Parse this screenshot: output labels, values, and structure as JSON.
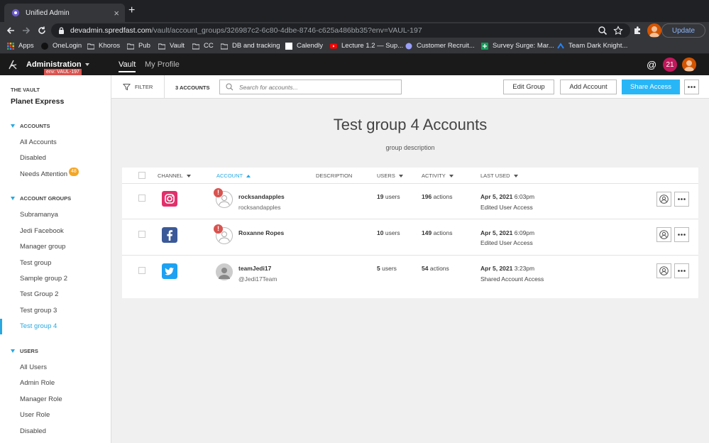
{
  "browser": {
    "tab_title": "Unified Admin",
    "new_tab": "+",
    "close": "×",
    "url_host": "devadmin.spredfast.com",
    "url_path": "/vault/account_groups/326987c2-6c80-4dbe-8746-c625a486bb35?env=VAUL-197",
    "update_label": "Update",
    "bookmarks": [
      "Apps",
      "OneLogin",
      "Khoros",
      "Pub",
      "Vault",
      "CC",
      "DB and tracking",
      "Calendly",
      "Lecture 1.2 — Sup...",
      "Customer Recruit...",
      "Survey Surge: Mar...",
      "Team Dark Knight..."
    ]
  },
  "header": {
    "app_title": "Administration",
    "env_badge": "env: VAUL-197",
    "nav": [
      "Vault",
      "My Profile"
    ],
    "at_symbol": "@",
    "notification_count": "21"
  },
  "sidebar": {
    "vault_label": "THE VAULT",
    "org_name": "Planet Express",
    "accounts_heading": "ACCOUNTS",
    "accounts_items": [
      "All Accounts",
      "Disabled",
      "Needs Attention"
    ],
    "needs_attention_count": "48",
    "groups_heading": "ACCOUNT GROUPS",
    "groups_items": [
      "Subramanya",
      "Jedi Facebook",
      "Manager group",
      "Test group",
      "Sample group 2",
      "Test Group 2",
      "Test group 3",
      "Test group 4"
    ],
    "active_group": "Test group 4",
    "users_heading": "USERS",
    "users_items": [
      "All Users",
      "Admin Role",
      "Manager Role",
      "User Role",
      "Disabled"
    ]
  },
  "toolbar": {
    "filter_label": "FILTER",
    "account_count": "3 ACCOUNTS",
    "search_placeholder": "Search for accounts...",
    "edit_group": "Edit Group",
    "add_account": "Add Account",
    "share_access": "Share Access"
  },
  "page": {
    "title": "Test group 4 Accounts",
    "description": "group description"
  },
  "table": {
    "columns": [
      "CHANNEL",
      "ACCOUNT",
      "DESCRIPTION",
      "USERS",
      "ACTIVITY",
      "LAST USED"
    ],
    "sorted_column": "ACCOUNT",
    "rows": [
      {
        "channel": "instagram",
        "warning": true,
        "name": "rocksandapples",
        "handle": "rocksandapples",
        "users_count": "19",
        "users_unit": "users",
        "activity_count": "196",
        "activity_unit": "actions",
        "last_used_date": "Apr 5, 2021",
        "last_used_time": "6:03pm",
        "last_used_action": "Edited User Access"
      },
      {
        "channel": "facebook",
        "warning": true,
        "name": "Roxanne Ropes",
        "handle": "",
        "users_count": "10",
        "users_unit": "users",
        "activity_count": "149",
        "activity_unit": "actions",
        "last_used_date": "Apr 5, 2021",
        "last_used_time": "6:09pm",
        "last_used_action": "Edited User Access"
      },
      {
        "channel": "twitter",
        "warning": false,
        "name": "teamJedi17",
        "handle": "@Jedi17Team",
        "users_count": "5",
        "users_unit": "users",
        "activity_count": "54",
        "activity_unit": "actions",
        "last_used_date": "Apr 5, 2021",
        "last_used_time": "3:23pm",
        "last_used_action": "Shared Account Access"
      }
    ],
    "warning_glyph": "!"
  },
  "colors": {
    "accent": "#29a8e0",
    "primary_button": "#29b6f6",
    "warning": "#d9534f",
    "badge": "#f5a623",
    "instagram": "#e1306c",
    "facebook": "#3b5998",
    "twitter": "#1da1f2",
    "notification": "#c2185b"
  },
  "icons": [
    "settings-gear-icon",
    "back-arrow-icon",
    "forward-arrow-icon",
    "reload-icon",
    "lock-icon",
    "zoom-icon",
    "star-icon",
    "extensions-icon",
    "khoros-logo-icon",
    "filter-icon",
    "search-icon",
    "instagram-icon",
    "facebook-icon",
    "twitter-icon",
    "user-icon",
    "more-icon",
    "at-icon"
  ]
}
